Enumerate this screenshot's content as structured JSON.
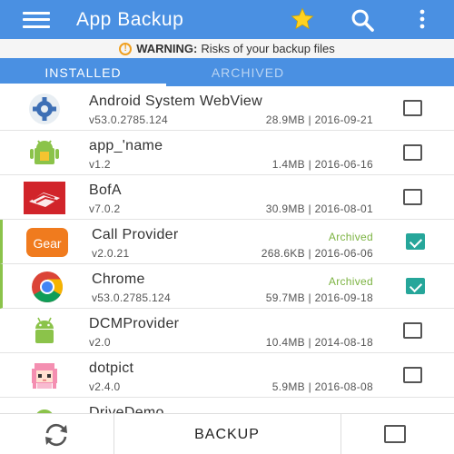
{
  "appbar": {
    "title": "App Backup",
    "menu_icon": "hamburger-menu-icon",
    "star_icon": "star-icon",
    "search_icon": "search-icon",
    "more_icon": "more-vert-icon",
    "color": "#4a90e2"
  },
  "warning": {
    "label": "WARNING:",
    "text": "Risks of your backup files"
  },
  "tabs": [
    {
      "label": "INSTALLED",
      "selected": true
    },
    {
      "label": "ARCHIVED",
      "selected": false
    }
  ],
  "apps": [
    {
      "name": "Android System WebView",
      "version": "v53.0.2785.124",
      "meta": "28.9MB | 2016-09-21",
      "status": "",
      "checked": false,
      "icon": "webview-gear-icon"
    },
    {
      "name": "app_'name",
      "version": "v1.2",
      "meta": "1.4MB | 2016-06-16",
      "status": "",
      "checked": false,
      "icon": "android-box-icon"
    },
    {
      "name": "BofA",
      "version": "v7.0.2",
      "meta": "30.9MB | 2016-08-01",
      "status": "",
      "checked": false,
      "icon": "bofa-flag-icon"
    },
    {
      "name": "Call Provider",
      "version": "v2.0.21",
      "meta": "268.6KB | 2016-06-06",
      "status": "Archived",
      "checked": true,
      "icon": "gear-logo-icon",
      "icon_text": "Gear"
    },
    {
      "name": "Chrome",
      "version": "v53.0.2785.124",
      "meta": "59.7MB | 2016-09-18",
      "status": "Archived",
      "checked": true,
      "icon": "chrome-icon"
    },
    {
      "name": "DCMProvider",
      "version": "v2.0",
      "meta": "10.4MB | 2014-08-18",
      "status": "",
      "checked": false,
      "icon": "android-robot-icon"
    },
    {
      "name": "dotpict",
      "version": "v2.4.0",
      "meta": "5.9MB | 2016-08-08",
      "status": "",
      "checked": false,
      "icon": "pixel-girl-icon"
    },
    {
      "name": "DriveDemo",
      "version": "",
      "meta": "",
      "status": "",
      "checked": false,
      "icon": "android-robot-icon"
    }
  ],
  "bottombar": {
    "refresh_icon": "refresh-icon",
    "backup_label": "BACKUP"
  }
}
